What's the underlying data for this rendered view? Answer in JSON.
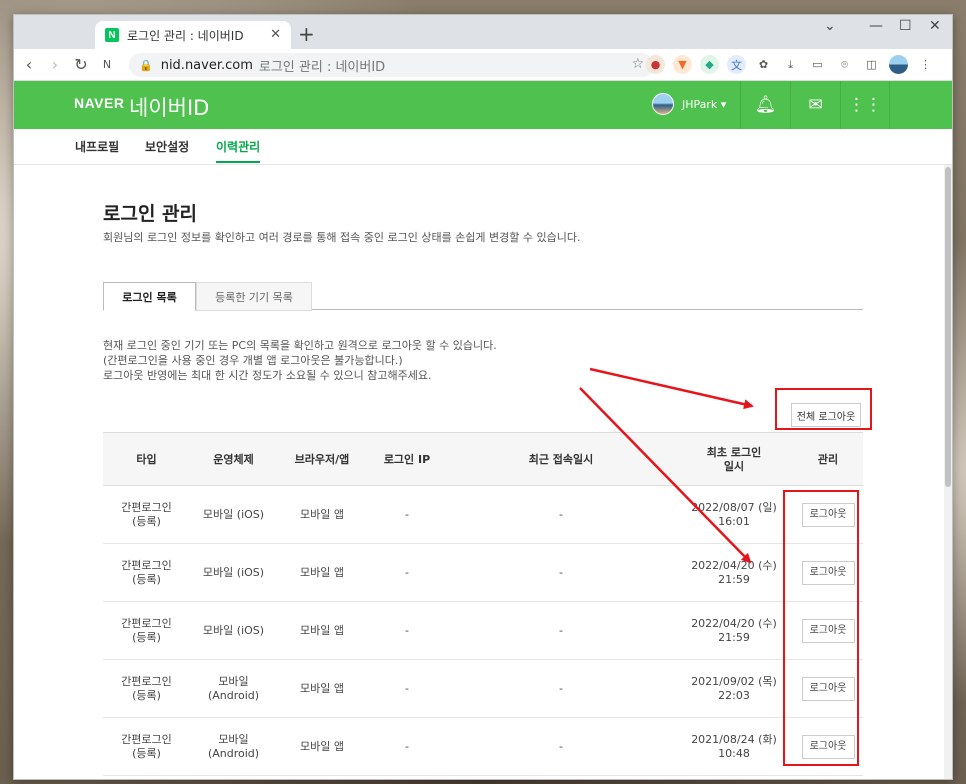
{
  "browser": {
    "tab_title": "로그인 관리 : 네이버ID",
    "tab_favicon": "N",
    "new_tab": "+",
    "url_host": "nid.naver.com",
    "url_title": "로그인 관리 : 네이버ID"
  },
  "header": {
    "logo": "NAVER",
    "logo_suffix": "네이버ID",
    "username": "JHPark ▾",
    "brand_color": "#4fc14e"
  },
  "subnav": {
    "items": [
      {
        "label": "내프로필"
      },
      {
        "label": "보안설정"
      },
      {
        "label": "이력관리"
      }
    ],
    "active": "이력관리"
  },
  "page": {
    "title": "로그인 관리",
    "description": "회원님의 로그인 정보를 확인하고 여러 경로를 통해 접속 중인 로그인 상태를 손쉽게 변경할 수 있습니다.",
    "tabs": [
      {
        "label": "로그인 목록"
      },
      {
        "label": "등록한 기기 목록"
      }
    ],
    "notice_lines": [
      "현재 로그인 중인 기기 또는 PC의 목록을 확인하고 원격으로 로그아웃 할 수 있습니다.",
      "(간편로그인을 사용 중인 경우 개별 앱 로그아웃은 불가능합니다.)",
      "로그아웃 반영에는 최대 한 시간 정도가 소요될 수 있으니 참고해주세요."
    ],
    "logout_all_label": "전체 로그아웃"
  },
  "table": {
    "headers": {
      "type": "타입",
      "os": "운영체제",
      "browser": "브라우저/앱",
      "ip": "로그인 IP",
      "recent": "최근 접속일시",
      "first_line1": "최초 로그인",
      "first_line2": "일시",
      "manage": "관리"
    },
    "rows": [
      {
        "type1": "간편로그인",
        "type2": "(등록)",
        "os1": "모바일 (iOS)",
        "os2": "",
        "browser": "모바일 앱",
        "ip": "-",
        "recent": "-",
        "date": "2022/08/07 (일)",
        "time": "16:01",
        "action": "로그아웃"
      },
      {
        "type1": "간편로그인",
        "type2": "(등록)",
        "os1": "모바일 (iOS)",
        "os2": "",
        "browser": "모바일 앱",
        "ip": "-",
        "recent": "-",
        "date": "2022/04/20 (수)",
        "time": "21:59",
        "action": "로그아웃"
      },
      {
        "type1": "간편로그인",
        "type2": "(등록)",
        "os1": "모바일 (iOS)",
        "os2": "",
        "browser": "모바일 앱",
        "ip": "-",
        "recent": "-",
        "date": "2022/04/20 (수)",
        "time": "21:59",
        "action": "로그아웃"
      },
      {
        "type1": "간편로그인",
        "type2": "(등록)",
        "os1": "모바일",
        "os2": "(Android)",
        "browser": "모바일 앱",
        "ip": "-",
        "recent": "-",
        "date": "2021/09/02 (목)",
        "time": "22:03",
        "action": "로그아웃"
      },
      {
        "type1": "간편로그인",
        "type2": "(등록)",
        "os1": "모바일",
        "os2": "(Android)",
        "browser": "모바일 앱",
        "ip": "-",
        "recent": "-",
        "date": "2021/08/24 (화)",
        "time": "10:48",
        "action": "로그아웃"
      }
    ]
  },
  "annotation_color": "#e5151b"
}
